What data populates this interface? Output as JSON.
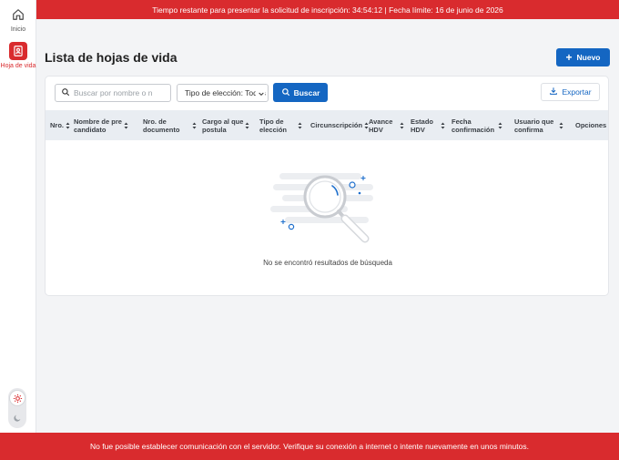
{
  "sidebar": {
    "items": [
      {
        "label": "Inicio",
        "icon": "home-icon"
      },
      {
        "label": "Hoja de vida",
        "icon": "cv-document-icon",
        "active": true
      }
    ],
    "theme_icons": [
      "sun-icon",
      "moon-icon"
    ]
  },
  "banners": {
    "top": "Tiempo restante para presentar la solicitud de inscripción: 34:54:12 | Fecha límite: 16 de junio de 2026",
    "bottom": "No fue posible establecer comunicación con el servidor. Verifique su conexión a internet o intente nuevamente en unos minutos."
  },
  "page": {
    "title": "Lista de hojas de vida",
    "new_button": "Nuevo"
  },
  "filters": {
    "search_placeholder": "Buscar por nombre o n",
    "election_type": "Tipo de elección: Todos",
    "search_button": "Buscar",
    "export_button": "Exportar"
  },
  "table": {
    "columns": [
      {
        "line1": "Nro.",
        "line2": ""
      },
      {
        "line1": "Nombre de pre",
        "line2": "candidato"
      },
      {
        "line1": "Nro. de",
        "line2": "documento"
      },
      {
        "line1": "Cargo al que",
        "line2": "postula"
      },
      {
        "line1": "Tipo de",
        "line2": "elección"
      },
      {
        "line1": "Circunscripción",
        "line2": ""
      },
      {
        "line1": "Avance",
        "line2": "HDV"
      },
      {
        "line1": "Estado",
        "line2": "HDV"
      },
      {
        "line1": "Fecha",
        "line2": "confirmación"
      },
      {
        "line1": "Usuario que",
        "line2": "confirma"
      },
      {
        "line1": "Opciones",
        "line2": ""
      }
    ],
    "empty_message": "No se encontró resultados de búsqueda"
  },
  "colors": {
    "brand_red": "#d92b2e",
    "primary_blue": "#1466c2",
    "header_bg": "#e9edf2"
  }
}
